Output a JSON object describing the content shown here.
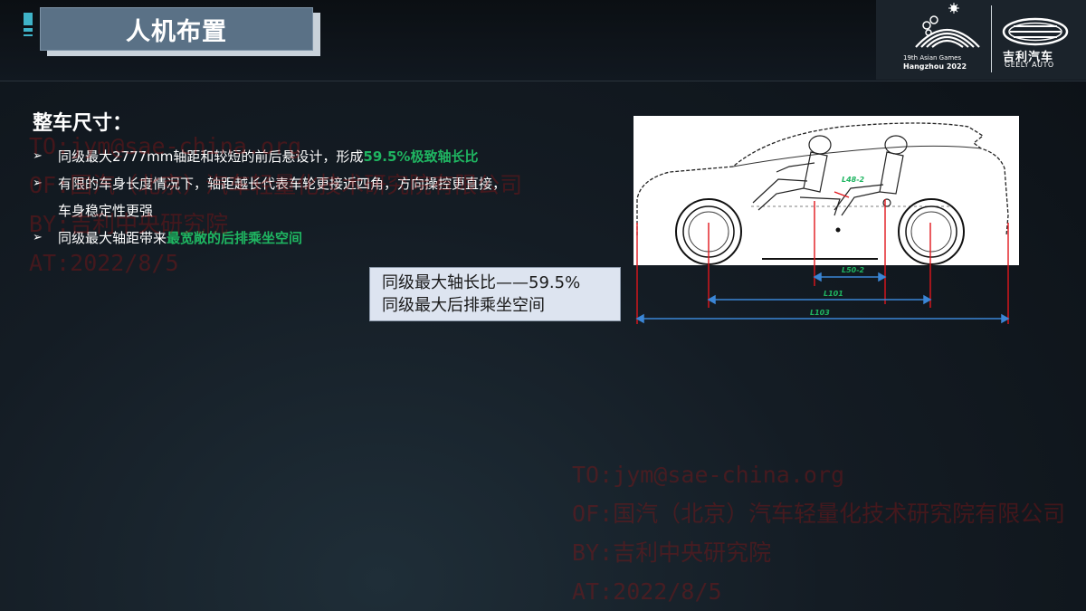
{
  "header": {
    "title": "人机布置"
  },
  "logos": {
    "games_line1": "19th Asian Games",
    "games_line2": "Hangzhou 2022",
    "brand_cn": "吉利汽车",
    "brand_en": "GEELY AUTO"
  },
  "main": {
    "heading": "整车尺寸：",
    "bullets": [
      {
        "text": "同级最大2777mm轴距和较短的前后悬设计，形成",
        "highlight": "59.5%极致轴长比",
        "rest": "",
        "cont": ""
      },
      {
        "text": "有限的车身长度情况下，轴距越长代表车轮更接近四角，方向操控更直接，",
        "highlight": "",
        "rest": "",
        "cont": "车身稳定性更强"
      },
      {
        "text": "同级最大轴距带来",
        "highlight": "最宽敞的后排乘坐空间",
        "rest": "",
        "cont": ""
      }
    ],
    "callout": {
      "line1": "同级最大轴长比——59.5%",
      "line2": "同级最大后排乘坐空间"
    }
  },
  "diagram": {
    "labels": {
      "l48": "L48-2",
      "l50": "L50-2",
      "l101": "L101",
      "l103": "L103"
    }
  },
  "watermark": {
    "left": [
      "TO:jym@sae-china.org",
      "OF:国汽（北京）汽车轻量化技术研究院有限公司",
      "BY:吉利中央研究院",
      "AT:2022/8/5"
    ],
    "right": [
      "TO:jym@sae-china.org",
      "OF:国汽（北京）汽车轻量化技术研究院有限公司",
      "BY:吉利中央研究院",
      "AT:2022/8/5"
    ]
  },
  "colors": {
    "highlight": "#1fb561",
    "title_box": "#5a7186",
    "dimension_line": "#3b86d6",
    "marker_line": "#e0161c"
  }
}
